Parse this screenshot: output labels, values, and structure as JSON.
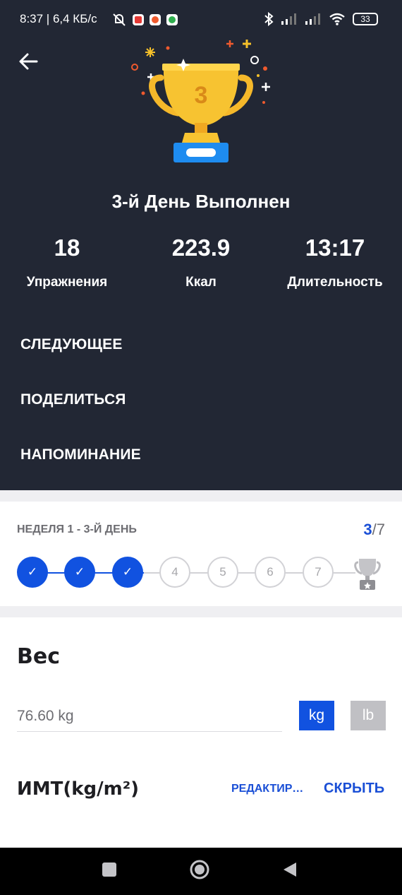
{
  "status_bar": {
    "time_and_speed": "8:37 | 6,4 КБ/с",
    "battery": "33",
    "icons": [
      "notifications-muted-icon",
      "app-icon-red",
      "app-icon-record",
      "app-icon-green",
      "bluetooth-icon",
      "signal-icon",
      "signal-icon",
      "wifi-icon",
      "battery-icon"
    ]
  },
  "header": {
    "back_icon": "arrow-left-icon",
    "trophy_number": "3",
    "title": "3-й День Выполнен"
  },
  "stats": [
    {
      "value": "18",
      "label": "Упражнения"
    },
    {
      "value": "223.9",
      "label": "Ккал"
    },
    {
      "value": "13:17",
      "label": "Длительность"
    }
  ],
  "menu": {
    "next": "СЛЕДУЮЩЕЕ",
    "share": "ПОДЕЛИТЬСЯ",
    "reminder": "НАПОМИНАНИЕ"
  },
  "week": {
    "label": "НЕДЕЛЯ 1 - 3-Й ДЕНЬ",
    "current": "3",
    "total": "/7",
    "days": [
      "✓",
      "✓",
      "✓",
      "4",
      "5",
      "6",
      "7"
    ],
    "completed": 3,
    "accent": "#1152e0"
  },
  "weight": {
    "title": "Вес",
    "value": "76.60 kg",
    "unit_kg": "kg",
    "unit_lb": "lb",
    "selected_unit": "kg"
  },
  "bmi": {
    "title": "ИМТ(kg/m²)",
    "edit": "РЕДАКТИРОВАТЬ",
    "hide": "СКРЫТЬ"
  },
  "nav": {
    "recents_icon": "square-icon",
    "home_icon": "circle-icon",
    "back_icon": "triangle-back-icon"
  }
}
